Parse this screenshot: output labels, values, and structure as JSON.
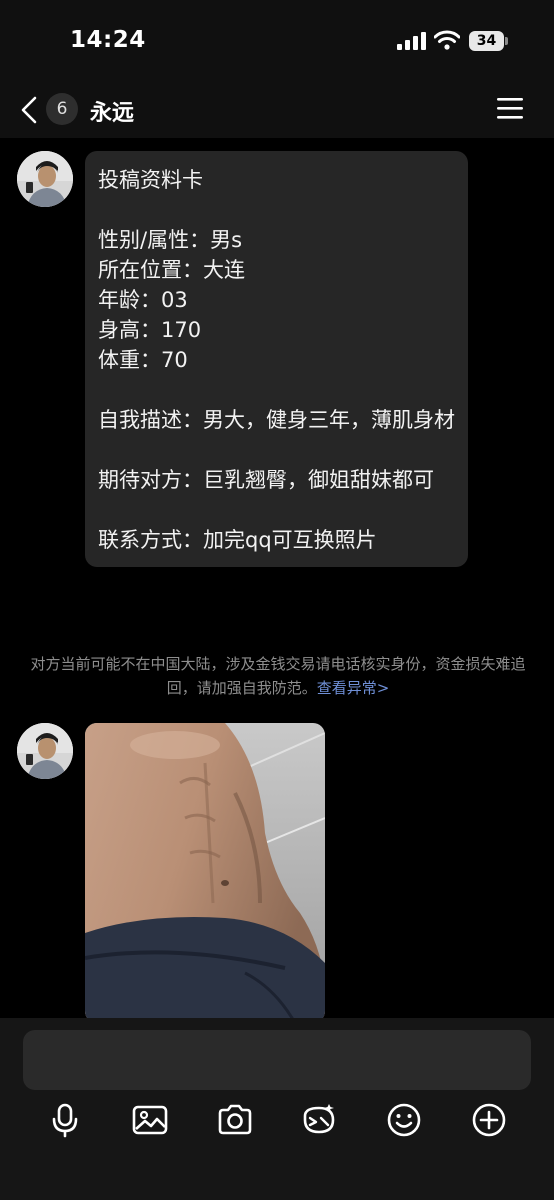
{
  "status_bar": {
    "time": "14:24",
    "battery_level": "34"
  },
  "nav": {
    "unread_count": "6",
    "contact_name": "永远"
  },
  "messages": {
    "card": {
      "title": "投稿资料卡",
      "gender": "性别/属性：男s",
      "location": "所在位置：大连",
      "age": "年龄：03",
      "height": "身高：170",
      "weight": "体重：70",
      "self_desc": "自我描述：男大，健身三年，薄肌身材",
      "expect": "期待对方：巨乳翘臀，御姐甜妹都可",
      "contact": "联系方式：加完qq可互换照片"
    },
    "notice": {
      "text": "对方当前可能不在中国大陆，涉及金钱交易请电话核实身份，资金损失难追回，请加强自我防范。",
      "link": "查看异常>"
    }
  },
  "input": {
    "placeholder": ""
  },
  "toolbar": {
    "icons": [
      "microphone-icon",
      "image-icon",
      "camera-icon",
      "sticker-icon",
      "emoji-icon",
      "plus-icon"
    ]
  },
  "colors": {
    "bubble": "#262626",
    "background": "#000000",
    "link": "#6f8fd6"
  }
}
